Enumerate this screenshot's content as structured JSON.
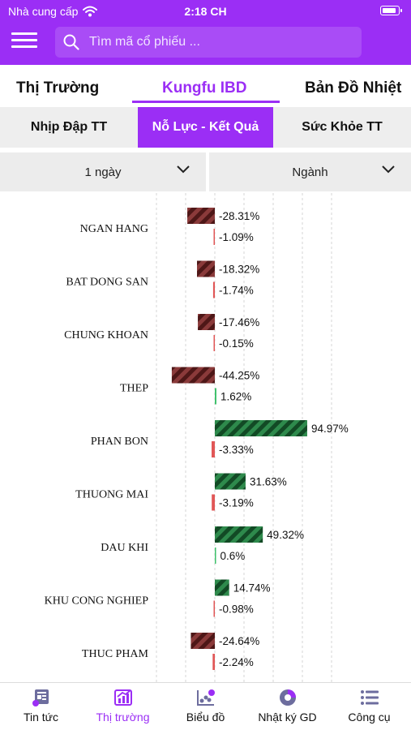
{
  "status_bar": {
    "carrier": "Nhà cung cấp",
    "time": "2:18 CH"
  },
  "search": {
    "placeholder": "Tìm mã cổ phiếu ..."
  },
  "main_tabs": [
    {
      "label": "Thị Trường",
      "active": false
    },
    {
      "label": "Kungfu IBD",
      "active": true
    },
    {
      "label": "Bản Đồ Nhiệt",
      "active": false
    }
  ],
  "sub_tabs": [
    {
      "label": "Nhịp Đập TT",
      "active": false
    },
    {
      "label": "Nỗ Lực - Kết Quả",
      "active": true
    },
    {
      "label": "Sức Khỏe TT",
      "active": false
    }
  ],
  "filters": {
    "period": "1 ngày",
    "group": "Ngành"
  },
  "colors": {
    "brand": "#9b2ef5",
    "negative_effort": "#7a2a2a",
    "positive_effort": "#1f6b3a",
    "negative_result": "#e15757",
    "positive_result": "#3cc06a"
  },
  "chart_data": {
    "type": "bar",
    "orientation": "horizontal",
    "categories": [
      "NGAN HANG",
      "BAT DONG SAN",
      "CHUNG KHOAN",
      "THEP",
      "PHAN BON",
      "THUONG MAI",
      "DAU KHI",
      "KHU CONG NGHIEP",
      "THUC PHAM"
    ],
    "series": [
      {
        "values": [
          -28.31,
          -18.32,
          -17.46,
          -44.25,
          94.97,
          31.63,
          49.32,
          14.74,
          -24.64
        ],
        "labels": [
          "-28.31%",
          "-18.32%",
          "-17.46%",
          "-44.25%",
          "94.97%",
          "31.63%",
          "49.32%",
          "14.74%",
          "-24.64%"
        ],
        "style": "hatched"
      },
      {
        "values": [
          -1.09,
          -1.74,
          -0.15,
          1.62,
          -3.33,
          -3.19,
          0.6,
          -0.98,
          -2.24
        ],
        "labels": [
          "-1.09%",
          "-1.74%",
          "-0.15%",
          "1.62%",
          "-3.33%",
          "-3.19%",
          "0.6%",
          "-0.98%",
          "-2.24%"
        ],
        "style": "solid"
      }
    ],
    "grid": true
  },
  "bottom_nav": [
    {
      "label": "Tin tức",
      "icon": "news-icon",
      "active": false
    },
    {
      "label": "Thị trường",
      "icon": "market-chart-icon",
      "active": true
    },
    {
      "label": "Biểu đồ",
      "icon": "scatter-chart-icon",
      "active": false
    },
    {
      "label": "Nhật ký GD",
      "icon": "pie-journal-icon",
      "active": false
    },
    {
      "label": "Công cụ",
      "icon": "tools-list-icon",
      "active": false
    }
  ]
}
